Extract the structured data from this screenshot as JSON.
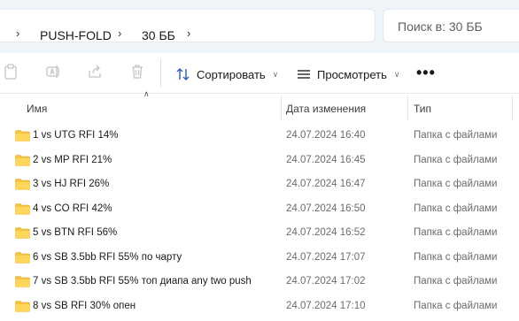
{
  "breadcrumb": {
    "items": [
      "PUSH-FOLD",
      "30 ББ"
    ]
  },
  "search": {
    "placeholder": "Поиск в: 30 ББ"
  },
  "toolbar": {
    "sort_label": "Сортировать",
    "view_label": "Просмотреть",
    "more_label": "•••"
  },
  "columns": {
    "name": "Имя",
    "date": "Дата изменения",
    "type": "Тип"
  },
  "files": [
    {
      "name": "1 vs UTG RFI 14%",
      "date": "24.07.2024 16:40",
      "type": "Папка с файлами"
    },
    {
      "name": "2 vs MP RFI 21%",
      "date": "24.07.2024 16:45",
      "type": "Папка с файлами"
    },
    {
      "name": "3 vs HJ RFI 26%",
      "date": "24.07.2024 16:47",
      "type": "Папка с файлами"
    },
    {
      "name": "4 vs CO RFI 42%",
      "date": "24.07.2024 16:50",
      "type": "Папка с файлами"
    },
    {
      "name": "5 vs BTN RFI 56%",
      "date": "24.07.2024 16:52",
      "type": "Папка с файлами"
    },
    {
      "name": "6 vs SB 3.5bb RFI 55% по чарту",
      "date": "24.07.2024 17:07",
      "type": "Папка с файлами"
    },
    {
      "name": "7 vs SB 3.5bb RFI 55% топ диапа any two push",
      "date": "24.07.2024 17:02",
      "type": "Папка с файлами"
    },
    {
      "name": "8 vs SB RFI 30% опен",
      "date": "24.07.2024 17:10",
      "type": "Папка с файлами"
    }
  ],
  "colors": {
    "folder": "#f5c542",
    "address_bg": "#eff4f9"
  }
}
